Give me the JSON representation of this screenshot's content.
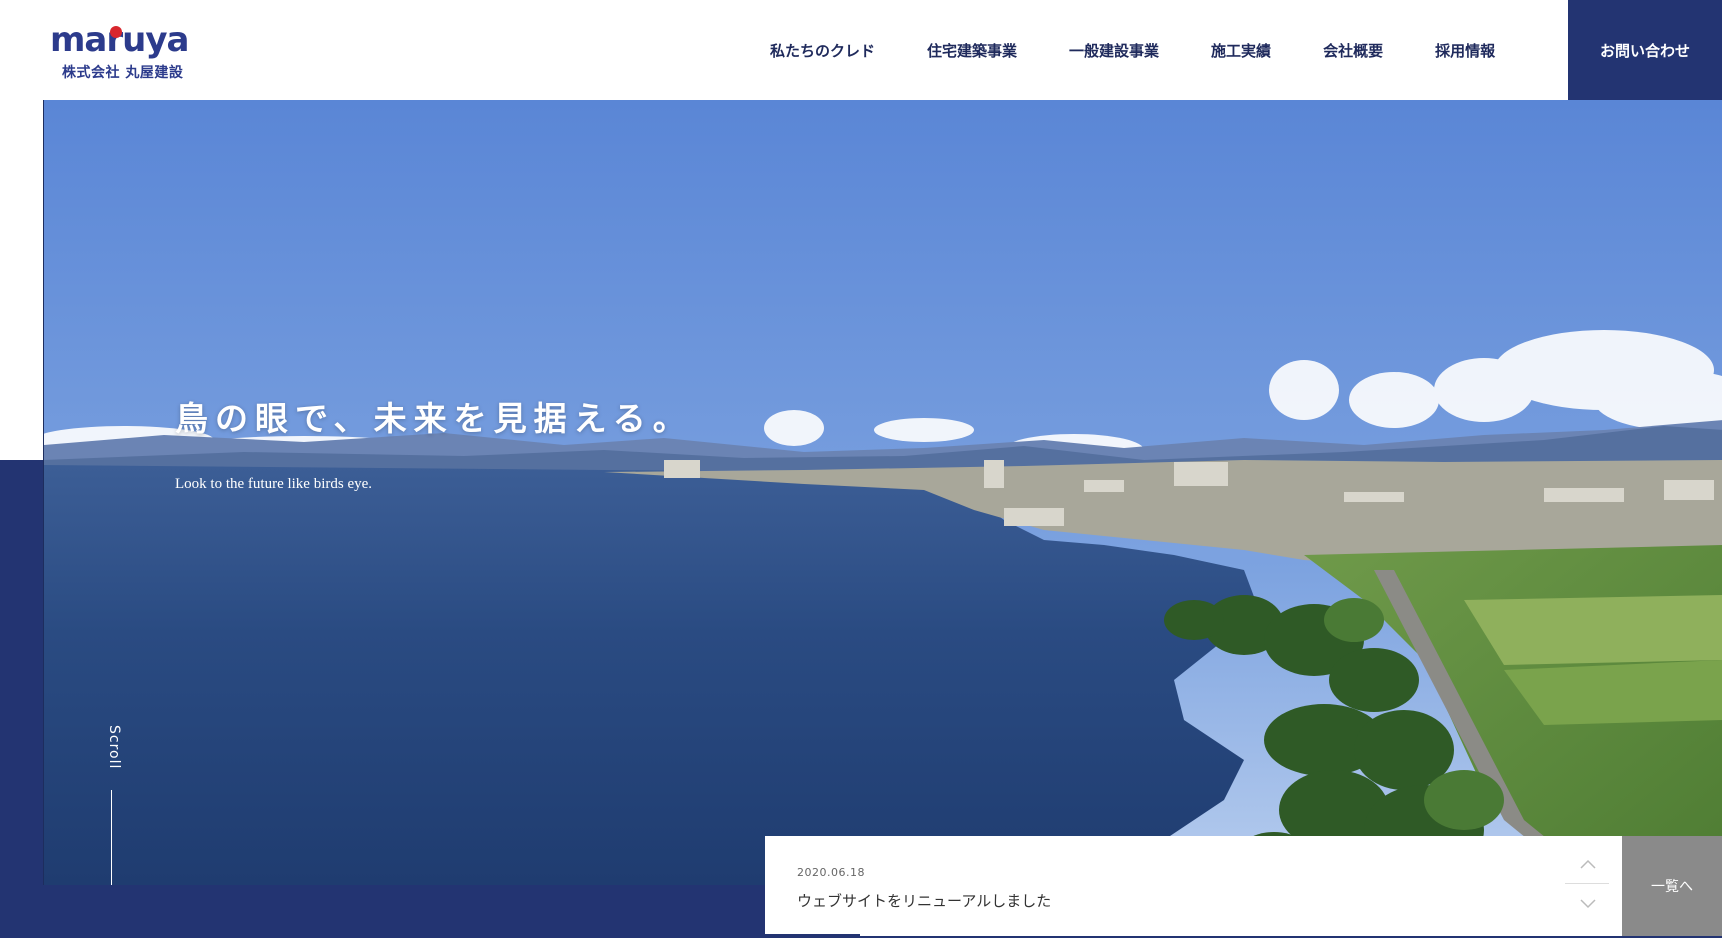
{
  "header": {
    "logo_word": "maruya",
    "logo_sub": "株式会社 丸屋建設",
    "nav": [
      {
        "label": "私たちのクレド"
      },
      {
        "label": "住宅建築事業"
      },
      {
        "label": "一般建設事業"
      },
      {
        "label": "施工実績"
      },
      {
        "label": "会社概要"
      },
      {
        "label": "採用情報"
      }
    ],
    "contact_label": "お問い合わせ"
  },
  "hero": {
    "title": "鳥の眼で、未来を見据える。",
    "subtitle": "Look to the future like birds eye."
  },
  "scroll": {
    "label": "Scroll"
  },
  "news": {
    "date": "2020.06.18",
    "title": "ウェブサイトをリニューアルしました",
    "list_label": "一覧へ"
  },
  "colors": {
    "brand_navy": "#233472",
    "logo_red": "#d8262d",
    "list_button_gray": "#8a8a8a"
  },
  "icons": {
    "arrow_up": "chevron-up-icon",
    "arrow_down": "chevron-down-icon"
  }
}
